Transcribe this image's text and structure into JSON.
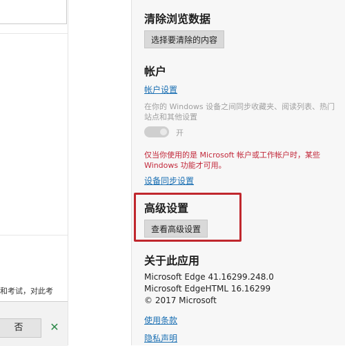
{
  "left_panel": {
    "partial_text": "和考试，对此考",
    "no_button_label": "否",
    "close_symbol": "✕"
  },
  "settings": {
    "clear_data": {
      "heading": "清除浏览数据",
      "button_label": "选择要清除的内容"
    },
    "account": {
      "heading": "帐户",
      "link": "帐户设置",
      "sync_description": "在你的 Windows 设备之间同步收藏夹、阅读列表、热门站点和其他设置",
      "toggle_label": "开",
      "toggle_state": "on-disabled",
      "warning": "仅当你使用的是 Microsoft 帐户或工作帐户时，某些 Windows 功能才可用。",
      "sync_settings_link": "设备同步设置"
    },
    "advanced": {
      "heading": "高级设置",
      "button_label": "查看高级设置"
    },
    "about": {
      "heading": "关于此应用",
      "version_edge": "Microsoft Edge 41.16299.248.0",
      "version_edgehtml": "Microsoft EdgeHTML 16.16299",
      "copyright": "© 2017 Microsoft",
      "terms_link": "使用条款",
      "privacy_link": "隐私声明"
    }
  },
  "colors": {
    "highlight": "#c0272d",
    "link": "#1a6fb3",
    "warning": "#c2283a"
  }
}
